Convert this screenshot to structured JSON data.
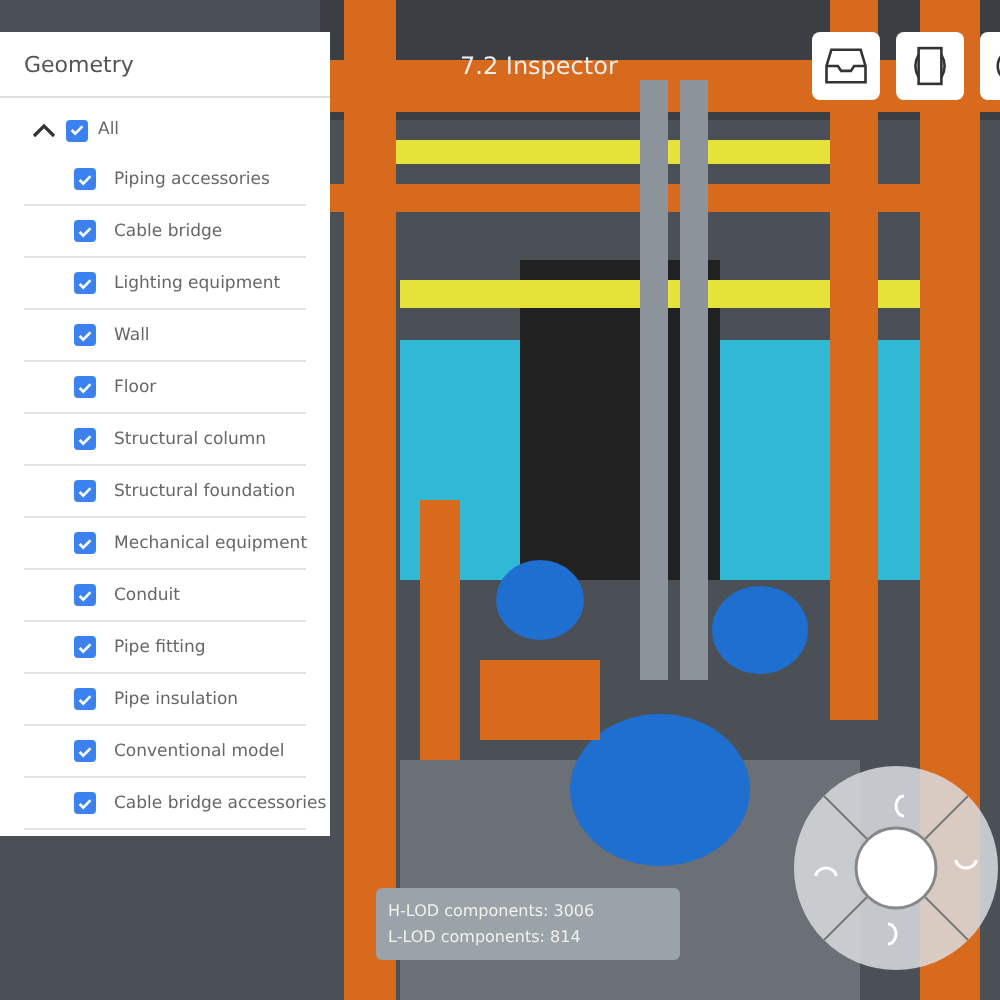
{
  "viewer": {
    "title": "7.2 Inspector",
    "toolbar": [
      {
        "kind": "tray"
      },
      {
        "kind": "frame"
      },
      {
        "kind": "rotate"
      }
    ]
  },
  "geometry_panel": {
    "title": "Geometry",
    "all": {
      "label": "All",
      "expanded": true,
      "checked": true
    },
    "items": [
      {
        "label": "Piping accessories",
        "checked": true
      },
      {
        "label": "Cable bridge",
        "checked": true
      },
      {
        "label": "Lighting equipment",
        "checked": true
      },
      {
        "label": "Wall",
        "checked": true
      },
      {
        "label": "Floor",
        "checked": true
      },
      {
        "label": "Structural column",
        "checked": true
      },
      {
        "label": "Structural foundation",
        "checked": true
      },
      {
        "label": "Mechanical equipment",
        "checked": true
      },
      {
        "label": "Conduit",
        "checked": true
      },
      {
        "label": "Pipe fitting",
        "checked": true
      },
      {
        "label": "Pipe insulation",
        "checked": true
      },
      {
        "label": "Conventional model",
        "checked": true
      },
      {
        "label": "Cable bridge accessories",
        "checked": true
      }
    ]
  },
  "stats": [
    "H-LOD components: 3006",
    "L-LOD components: 814"
  ]
}
